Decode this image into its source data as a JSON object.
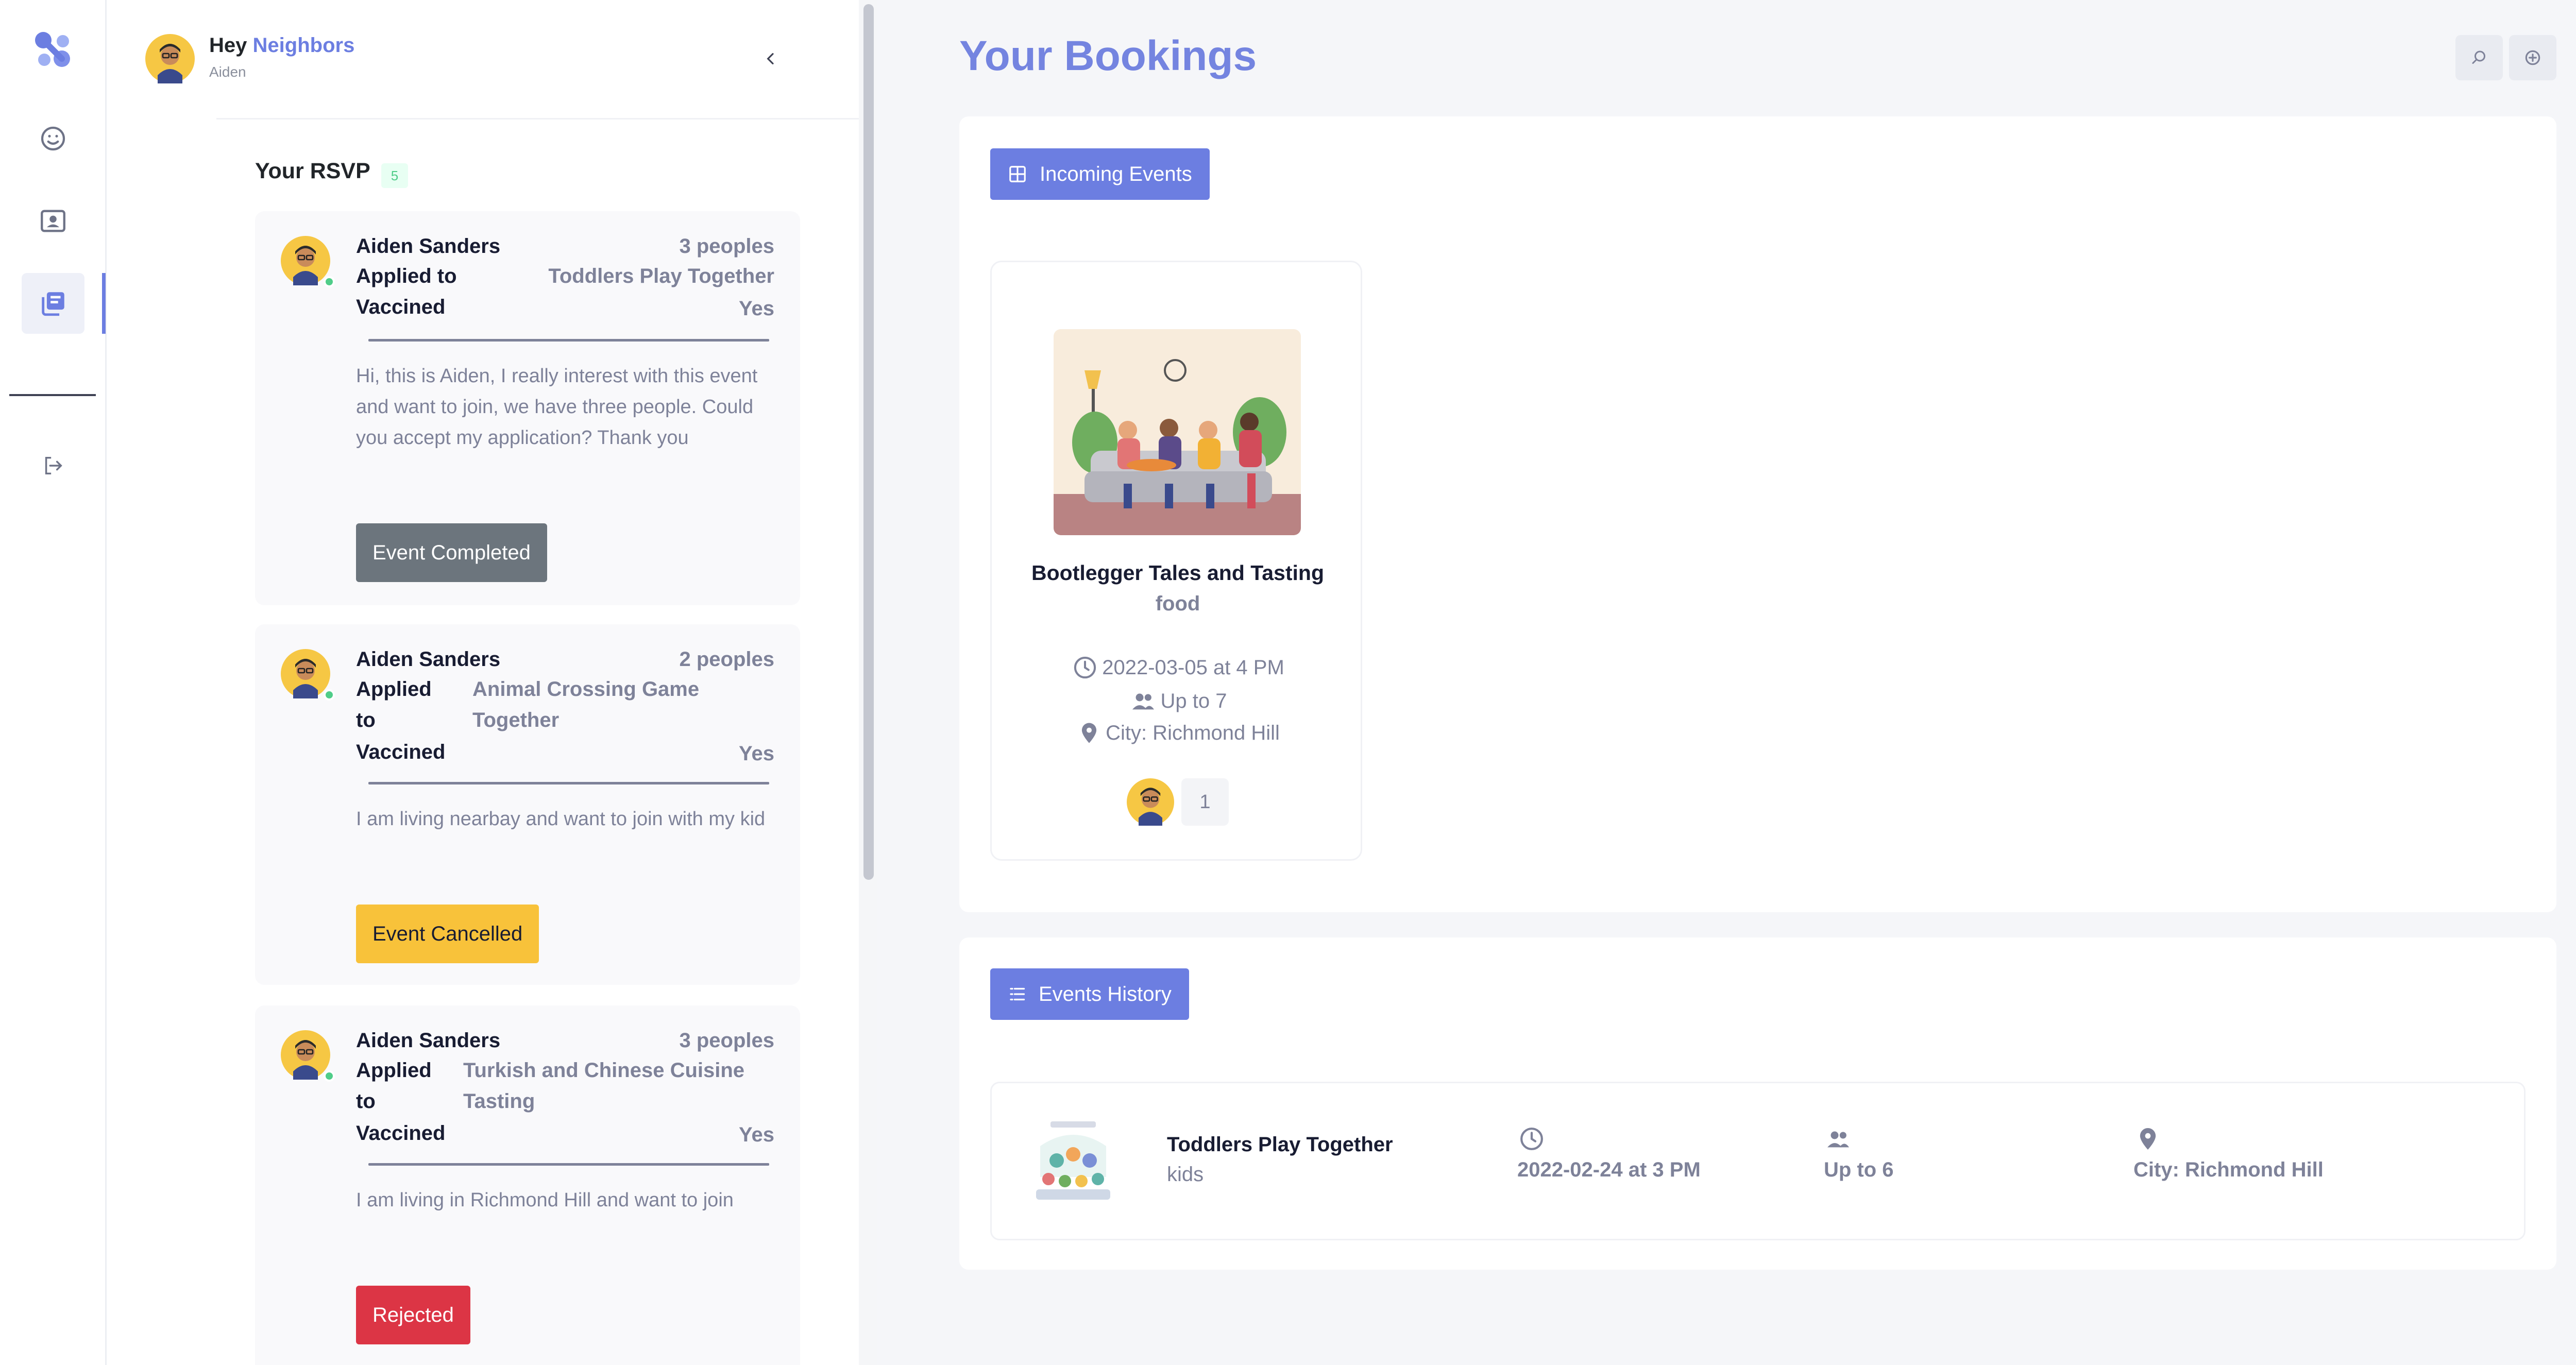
{
  "panel": {
    "greeting": "Hey",
    "greeting_name": "Neighbors",
    "subtitle": "Aiden",
    "rsvp_title": "Your RSVP",
    "rsvp_count": "5"
  },
  "rsvp": [
    {
      "name": "Aiden Sanders",
      "count": "3 peoples",
      "applied_label": "Applied to",
      "event": "Toddlers Play Together",
      "vaccined_label": "Vaccined",
      "vaccined": "Yes",
      "message": "Hi, this is Aiden, I really interest with this event and want to join, we have three people. Could you accept my application? Thank you",
      "status": "Event Completed"
    },
    {
      "name": "Aiden Sanders",
      "count": "2 peoples",
      "applied_label": "Applied to",
      "event": "Animal Crossing Game Together",
      "vaccined_label": "Vaccined",
      "vaccined": "Yes",
      "message": "I am living nearbay and want to join with my kid",
      "status": "Event Cancelled"
    },
    {
      "name": "Aiden Sanders",
      "count": "3 peoples",
      "applied_label": "Applied to",
      "event": "Turkish and Chinese Cuisine Tasting",
      "vaccined_label": "Vaccined",
      "vaccined": "Yes",
      "message": "I am living in Richmond Hill and want to join",
      "status": "Rejected"
    }
  ],
  "main": {
    "title": "Your Bookings",
    "incoming_label": "Incoming Events",
    "history_label": "Events History"
  },
  "incoming": [
    {
      "title": "Bootlegger Tales and Tasting",
      "category": "food",
      "datetime": "2022-03-05 at 4 PM",
      "capacity": "Up to 7",
      "city": "City: Richmond Hill",
      "attendees": "1"
    }
  ],
  "history": [
    {
      "title": "Toddlers Play Together",
      "category": "kids",
      "datetime": "2022-02-24 at 3 PM",
      "capacity": "Up to 6",
      "city": "City: Richmond Hill"
    }
  ],
  "icons": {
    "rail": [
      "app-logo",
      "smile-icon",
      "contact-card-icon",
      "bookings-icon",
      "logout-icon"
    ],
    "top": [
      "search-icon",
      "add-circle-icon"
    ]
  },
  "colors": {
    "accent": "#6c7ee1",
    "success": "#50cd89",
    "completed": "#6c757d",
    "cancelled": "#f8c23a",
    "rejected": "#dc3545"
  }
}
